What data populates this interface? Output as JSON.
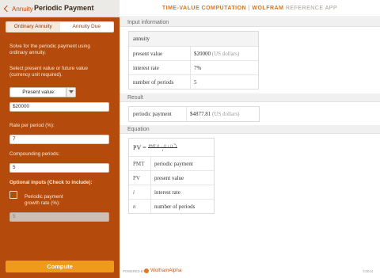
{
  "nav": {
    "back_label": "Annuity",
    "title": "Periodic Payment"
  },
  "tabs": [
    {
      "label": "Ordinary Annuity",
      "selected": true
    },
    {
      "label": "Annuity Due",
      "selected": false
    }
  ],
  "form": {
    "intro_line1": "Solve for the periodic payment using",
    "intro_line2": "ordinary annuity.",
    "select_help_line1": "Select present value or future value",
    "select_help_line2": "(currency unit required).",
    "value_type_selected": "Present value:",
    "value_input": "$20000",
    "rate_label": "Rate per period (%):",
    "rate_input": "7",
    "periods_label": "Compounding periods:",
    "periods_input": "5",
    "optional_label": "Optional inputs (Check to include):",
    "growth_label_line1": "Periodic payment",
    "growth_label_line2": "growth rate (%):",
    "growth_checked": false,
    "growth_input": "5"
  },
  "compute_label": "Compute",
  "app_header": {
    "title": "TIME-VALUE COMPUTATION",
    "separator": "|",
    "brand": "WOLFRAM",
    "subtitle": "REFERENCE APP"
  },
  "input_section": {
    "heading": "Input information",
    "type_label": "annuity",
    "rows": [
      {
        "label": "present value",
        "value": "$20000",
        "unit": "(US dollars)"
      },
      {
        "label": "interest rate",
        "value": "7%",
        "unit": ""
      },
      {
        "label": "number of periods",
        "value": "5",
        "unit": ""
      }
    ]
  },
  "result_section": {
    "heading": "Result",
    "label": "periodic payment",
    "value": "$4877.81",
    "unit": "(US dollars)"
  },
  "equation_section": {
    "heading": "Equation",
    "lhs": "PV",
    "numerator": "PMT (1 − (1 + i)",
    "exponent": "−n",
    "denominator": "i",
    "vars": [
      {
        "symbol": "PMT",
        "desc": "periodic payment"
      },
      {
        "symbol": "PV",
        "desc": "present value"
      },
      {
        "symbol": "i",
        "desc": "interest rate"
      },
      {
        "symbol": "n",
        "desc": "number of periods"
      }
    ]
  },
  "footer": {
    "powered_by": "POWERED BY",
    "brand": "WolframAlpha",
    "copyright": "©2014"
  },
  "colors": {
    "panel": "#b44a0b",
    "accent": "#f09a1b",
    "brand_orange": "#d9761a"
  }
}
